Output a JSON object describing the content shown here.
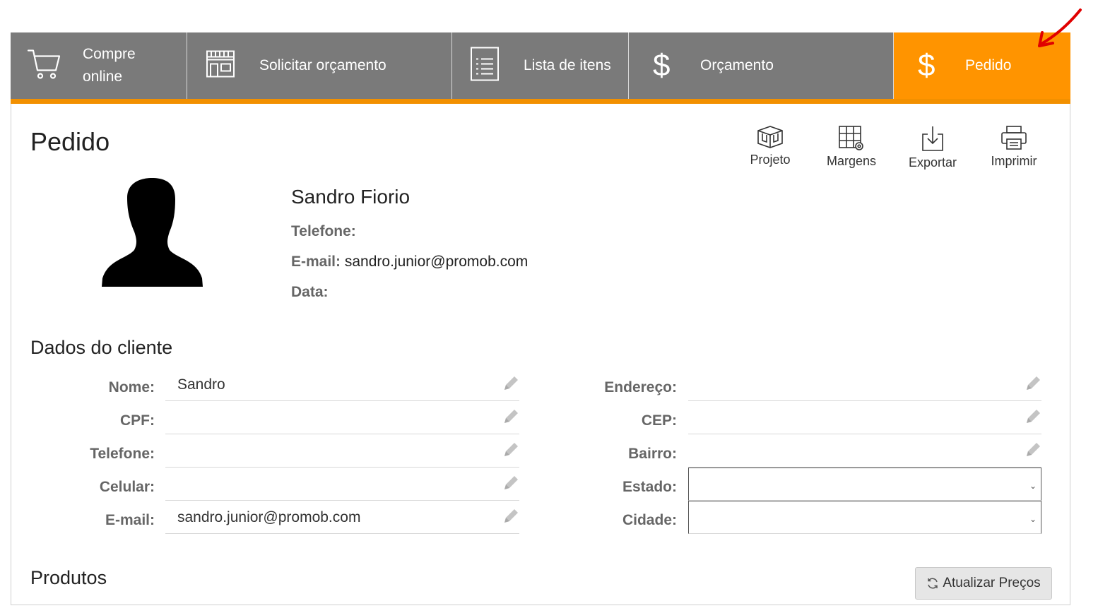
{
  "tabs": [
    {
      "line1": "Compre",
      "line2": "online",
      "icon": "cart-icon"
    },
    {
      "label": "Solicitar orçamento",
      "icon": "storefront-icon"
    },
    {
      "label": "Lista de itens",
      "icon": "list-document-icon"
    },
    {
      "label": "Orçamento",
      "icon": "dollar-icon"
    },
    {
      "label": "Pedido",
      "icon": "dollar-icon",
      "active": true
    }
  ],
  "colors": {
    "tab_bg": "#7a7a7a",
    "active_tab": "#ff9400",
    "accent": "#f29000",
    "annotation_arrow": "#e00000"
  },
  "page": {
    "title": "Pedido"
  },
  "toolbar": {
    "projeto": "Projeto",
    "margens": "Margens",
    "exportar": "Exportar",
    "imprimir": "Imprimir"
  },
  "profile": {
    "name": "Sandro Fiorio",
    "phone_label": "Telefone:",
    "phone_value": "",
    "email_label": "E-mail:",
    "email_value": "sandro.junior@promob.com",
    "date_label": "Data:",
    "date_value": ""
  },
  "client_section": {
    "title": "Dados do cliente",
    "left": [
      {
        "label": "Nome:",
        "value": "Sandro"
      },
      {
        "label": "CPF:",
        "value": ""
      },
      {
        "label": "Telefone:",
        "value": ""
      },
      {
        "label": "Celular:",
        "value": ""
      },
      {
        "label": "E-mail:",
        "value": "sandro.junior@promob.com"
      }
    ],
    "right": [
      {
        "label": "Endereço:",
        "value": ""
      },
      {
        "label": "CEP:",
        "value": ""
      },
      {
        "label": "Bairro:",
        "value": ""
      },
      {
        "label": "Estado:",
        "value": ""
      },
      {
        "label": "Cidade:",
        "value": ""
      }
    ]
  },
  "products": {
    "title": "Produtos",
    "update_button": "Atualizar Preços"
  }
}
